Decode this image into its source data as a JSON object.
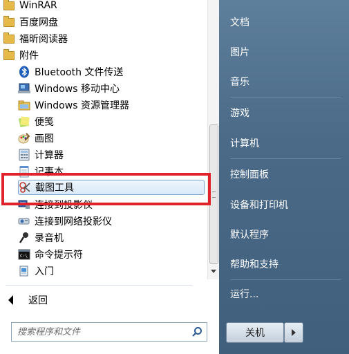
{
  "programs": {
    "folders": [
      {
        "label": "WinRAR"
      },
      {
        "label": "百度网盘"
      },
      {
        "label": "福昕阅读器"
      },
      {
        "label": "附件"
      }
    ],
    "accessories": [
      {
        "label": "Bluetooth 文件传送",
        "icon": "bluetooth-icon"
      },
      {
        "label": "Windows 移动中心",
        "icon": "mobility-center-icon"
      },
      {
        "label": "Windows 资源管理器",
        "icon": "explorer-icon"
      },
      {
        "label": "便笺",
        "icon": "sticky-notes-icon"
      },
      {
        "label": "画图",
        "icon": "paint-icon"
      },
      {
        "label": "计算器",
        "icon": "calculator-icon"
      },
      {
        "label": "记事本",
        "icon": "notepad-icon"
      },
      {
        "label": "截图工具",
        "icon": "snipping-tool-icon"
      },
      {
        "label": "连接到投影仪",
        "icon": "projector-icon"
      },
      {
        "label": "连接到网络投影仪",
        "icon": "network-projector-icon"
      },
      {
        "label": "录音机",
        "icon": "sound-recorder-icon"
      },
      {
        "label": "命令提示符",
        "icon": "command-prompt-icon"
      },
      {
        "label": "入门",
        "icon": "getting-started-icon"
      }
    ],
    "selected": "截图工具"
  },
  "back_label": "返回",
  "search": {
    "placeholder": "搜索程序和文件"
  },
  "right_menu": [
    {
      "label": "文档"
    },
    {
      "label": "图片"
    },
    {
      "label": "音乐"
    },
    {
      "label": "游戏"
    },
    {
      "label": "计算机"
    },
    {
      "label": "控制面板"
    },
    {
      "label": "设备和打印机"
    },
    {
      "label": "默认程序"
    },
    {
      "label": "帮助和支持"
    },
    {
      "label": "运行..."
    }
  ],
  "shutdown_label": "关机",
  "colors": {
    "highlight_box": "#e2222a",
    "right_panel": "#4a6a88"
  }
}
